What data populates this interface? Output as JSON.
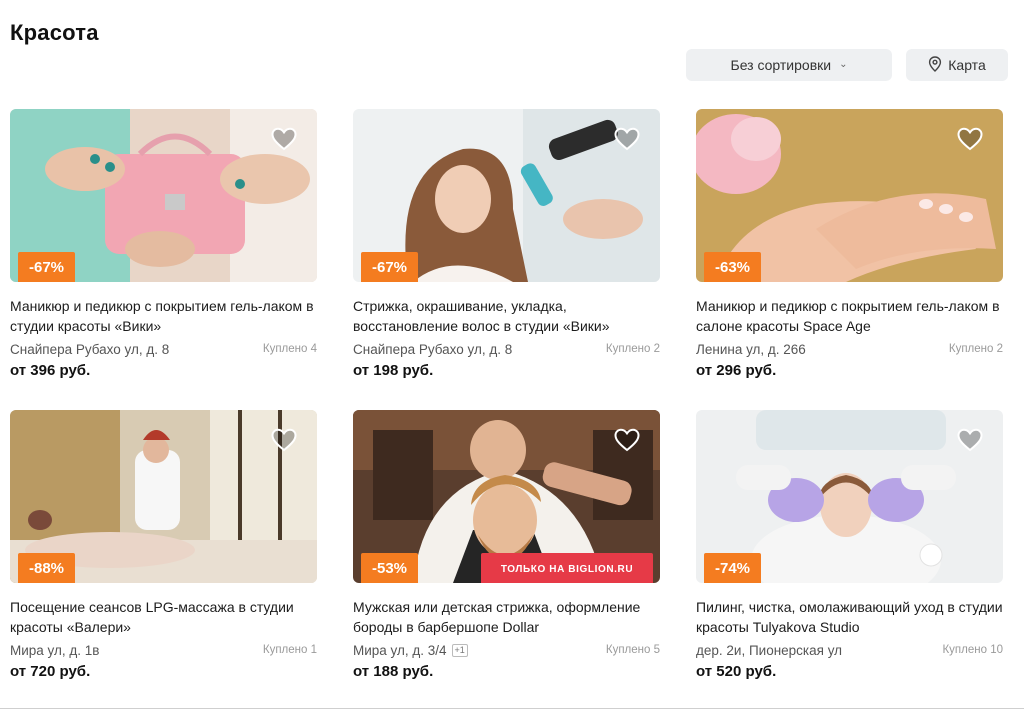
{
  "page": {
    "title": "Красота"
  },
  "toolbar": {
    "sort_label": "Без сортировки",
    "map_label": "Карта"
  },
  "cards": [
    {
      "title": "Маникюр и педикюр с покрытием гель-лаком в студии красоты «Вики»",
      "address": "Снайпера Рубахо ул, д. 8",
      "bought": "Куплено 4",
      "price": "от 396 руб.",
      "discount": "-67%"
    },
    {
      "title": "Стрижка, окрашивание, укладка, восстановление волос в студии «Вики»",
      "address": "Снайпера Рубахо ул, д. 8",
      "bought": "Куплено 2",
      "price": "от 198 руб.",
      "discount": "-67%"
    },
    {
      "title": "Маникюр и педикюр с покрытием гель-лаком в салоне красоты Space Age",
      "address": "Ленина ул, д. 266",
      "bought": "Куплено 2",
      "price": "от 296 руб.",
      "discount": "-63%"
    },
    {
      "title": "Посещение сеансов LPG-массажа в студии красоты «Валери»",
      "address": "Мира ул, д. 1в",
      "bought": "Куплено 1",
      "price": "от 720 руб.",
      "discount": "-88%"
    },
    {
      "title": "Мужская или детская стрижка, оформление бороды в барбершопе Dollar",
      "address": "Мира ул, д. 3/4",
      "address_extra": "+1",
      "bought": "Куплено 5",
      "price": "от 188 руб.",
      "discount": "-53%",
      "exclusive_label": "ТОЛЬКО НА BIGLION.RU"
    },
    {
      "title": "Пилинг, чистка, омолаживающий уход в студии красоты Tulyakova Studio",
      "address": "дер. 2и, Пионерская ул",
      "bought": "Куплено 10",
      "price": "от 520 руб.",
      "discount": "-74%"
    }
  ],
  "colors": {
    "discount": "#f47c20",
    "exclusive": "#e63a47",
    "button_bg": "#eef0f2"
  }
}
